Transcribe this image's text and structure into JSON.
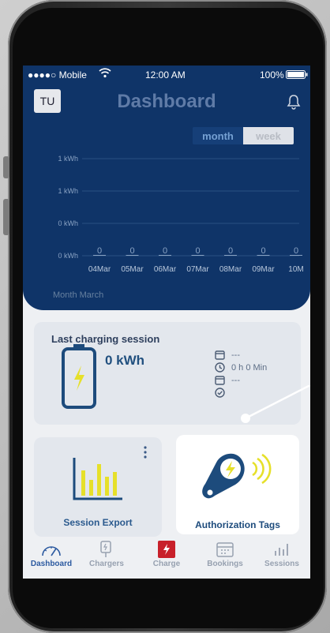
{
  "status_bar": {
    "carrier": "●●●●○ Mobile",
    "time": "12:00 AM",
    "battery": "100%"
  },
  "header": {
    "avatar": "TU",
    "title": "Dashboard"
  },
  "period_toggle": {
    "month": "month",
    "week": "week",
    "selected": "month"
  },
  "chart_data": {
    "type": "bar",
    "y_tick_labels": [
      "1 kWh",
      "1 kWh",
      "0 kWh",
      "0 kWh"
    ],
    "categories": [
      "04Mar",
      "05Mar",
      "06Mar",
      "07Mar",
      "08Mar",
      "09Mar",
      "10M"
    ],
    "values": [
      0,
      0,
      0,
      0,
      0,
      0,
      0
    ],
    "data_labels": [
      "0",
      "0",
      "0",
      "0",
      "0",
      "0",
      "0"
    ],
    "xlabel": "Month March",
    "colors": {
      "background": "#0f3468",
      "grid": "#2a4f82",
      "text": "#8aa3c4"
    }
  },
  "last_session": {
    "title": "Last charging session",
    "energy": "0 kWh",
    "date": "---",
    "duration": "0 h 0 Min",
    "end_date": "---"
  },
  "tiles": {
    "session_export": "Session Export",
    "authorization_tags": "Authorization Tags"
  },
  "tab_bar": [
    {
      "label": "Dashboard",
      "icon": "speedometer-icon",
      "active": true
    },
    {
      "label": "Chargers",
      "icon": "charger-plug-icon",
      "active": false
    },
    {
      "label": "Charge",
      "icon": "bolt-icon",
      "active": false
    },
    {
      "label": "Bookings",
      "icon": "calendar-icon",
      "active": false
    },
    {
      "label": "Sessions",
      "icon": "bar-chart-icon",
      "active": false
    }
  ],
  "colors": {
    "brand": "#0f3468",
    "accent": "#e6e02a",
    "charge": "#c8202a"
  }
}
